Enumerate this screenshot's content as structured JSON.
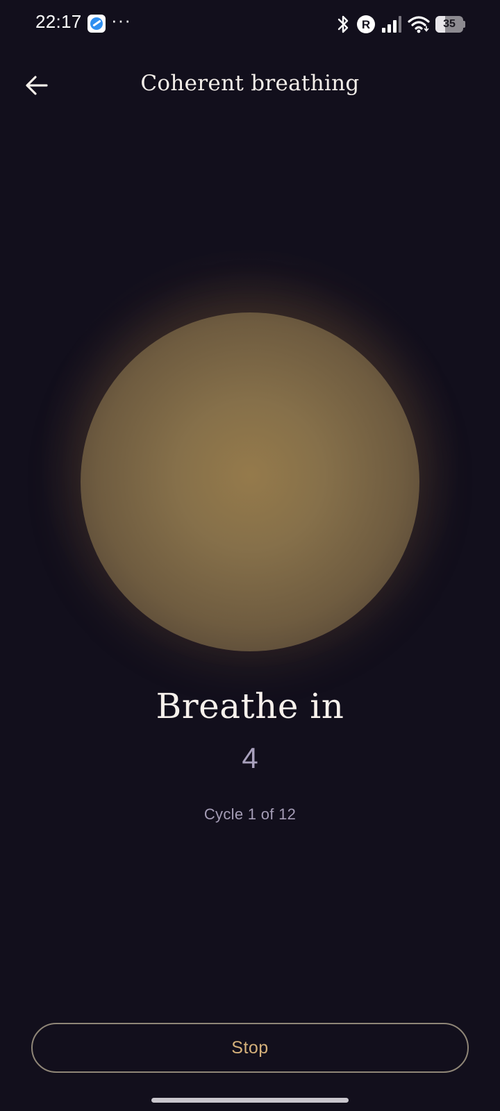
{
  "status_bar": {
    "time": "22:17",
    "more_indicator": "···",
    "battery_level": "35",
    "icons": [
      "app-notification-icon",
      "bluetooth-icon",
      "roaming-icon",
      "signal-icon",
      "wifi-icon",
      "battery-icon"
    ]
  },
  "header": {
    "title": "Coherent breathing",
    "back_icon": "arrow-left-icon"
  },
  "session": {
    "phase": "Breathe in",
    "count": "4",
    "cycle_text": "Cycle 1 of 12"
  },
  "actions": {
    "stop_label": "Stop"
  },
  "colors": {
    "background": "#120f1c",
    "orb": "#86704a",
    "accent": "#d4b07a",
    "button_border": "#8f8677",
    "muted_text": "#a59db6"
  }
}
